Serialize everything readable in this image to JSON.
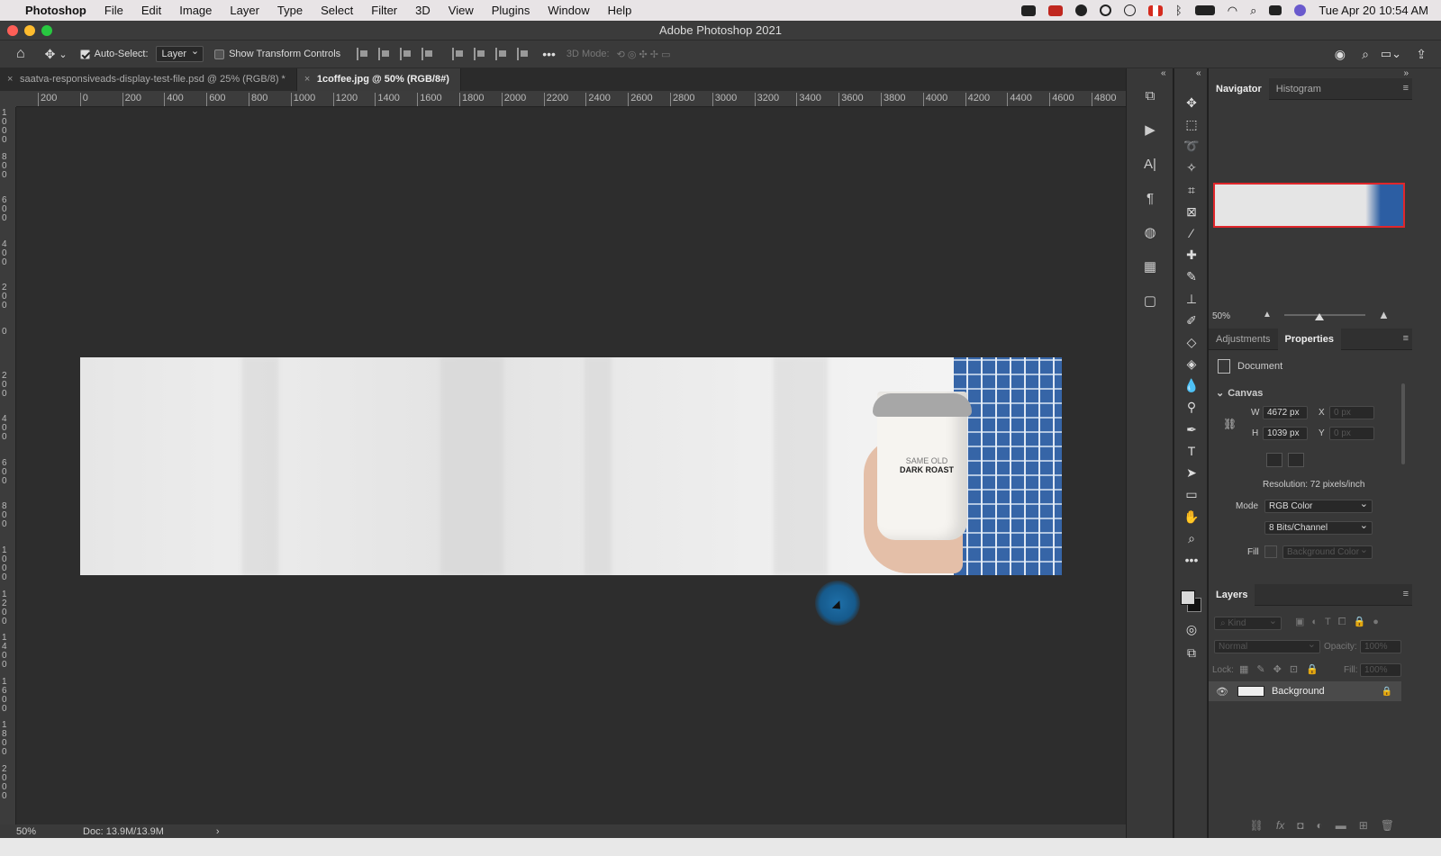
{
  "menubar": {
    "apple": "",
    "app": "Photoshop",
    "items": [
      "File",
      "Edit",
      "Image",
      "Layer",
      "Type",
      "Select",
      "Filter",
      "3D",
      "View",
      "Plugins",
      "Window",
      "Help"
    ],
    "clock": "Tue Apr 20  10:54 AM"
  },
  "window": {
    "title": "Adobe Photoshop 2021"
  },
  "options": {
    "auto_select_label": "Auto-Select:",
    "auto_select_value": "Layer",
    "transform_label": "Show Transform Controls",
    "mode3d_label": "3D Mode:"
  },
  "tabs": [
    {
      "label": "saatva-responsiveads-display-test-file.psd @ 25% (RGB/8) *",
      "close": "×"
    },
    {
      "label": "1coffee.jpg @ 50% (RGB/8#)",
      "close": "×"
    }
  ],
  "ruler": {
    "h": [
      "200",
      "0",
      "200",
      "400",
      "600",
      "800",
      "1000",
      "1200",
      "1400",
      "1600",
      "1800",
      "2000",
      "2200",
      "2400",
      "2600",
      "2800",
      "3000",
      "3200",
      "3400",
      "3600",
      "3800",
      "4000",
      "4200",
      "4400",
      "4600",
      "4800"
    ],
    "v": [
      "1000",
      "800",
      "600",
      "400",
      "200",
      "0",
      "200",
      "400",
      "600",
      "800",
      "1000",
      "1200",
      "1400",
      "1600",
      "1800",
      "2000"
    ]
  },
  "image": {
    "cup_brand_line1": "SAME OLD",
    "cup_brand_line2": "DARK ROAST"
  },
  "status": {
    "zoom": "50%",
    "doc": "Doc: 13.9M/13.9M",
    "arrow": "›"
  },
  "navigator": {
    "tab_navigator": "Navigator",
    "tab_histogram": "Histogram",
    "zoom": "50%"
  },
  "properties": {
    "tab_adjustments": "Adjustments",
    "tab_properties": "Properties",
    "doc_label": "Document",
    "canvas_label": "Canvas",
    "w_label": "W",
    "w_value": "4672 px",
    "h_label": "H",
    "h_value": "1039 px",
    "x_label": "X",
    "x_value": "0 px",
    "y_label": "Y",
    "y_value": "0 px",
    "resolution": "Resolution: 72 pixels/inch",
    "mode_label": "Mode",
    "mode_value": "RGB Color",
    "bits_value": "8 Bits/Channel",
    "fill_label": "Fill",
    "fill_value": "Background Color"
  },
  "layers": {
    "title": "Layers",
    "kind": "Kind",
    "blend": "Normal",
    "opacity_label": "Opacity:",
    "opacity_value": "100%",
    "lock_label": "Lock:",
    "fill_label": "Fill:",
    "fill_value": "100%",
    "items": [
      {
        "name": "Background"
      }
    ]
  },
  "colors": {
    "accent": "#1e6fa8",
    "menubar": "#e8e4e6",
    "canvas": "#2d2d2d"
  }
}
